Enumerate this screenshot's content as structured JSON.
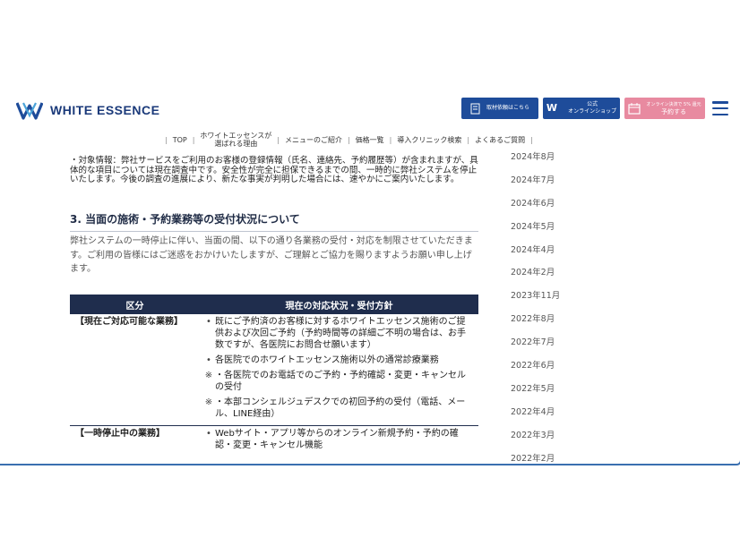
{
  "header": {
    "logo_text": "WHITE ESSENCE",
    "press_button": "取材依頼はこちら",
    "shop_button_line1": "公式",
    "shop_button_line2": "オンラインショップ",
    "reserve_button_small": "オンライン決済で 5% 還元",
    "reserve_button_main": "予約する"
  },
  "nav": {
    "items": [
      "TOP",
      "ホワイトエッセンスが",
      "選ばれる理由",
      "メニューのご紹介",
      "価格一覧",
      "導入クリニック検索",
      "よくあるご質問"
    ]
  },
  "content": {
    "intro": "・対象情報：弊社サービスをご利用のお客様の登録情報（氏名、連絡先、予約履歴等）が含まれますが、具体的な項目については現在調査中です。安全性が完全に担保できるまでの間、一時的に弊社システムを停止いたします。今後の調査の進展により、新たな事実が判明した場合には、速やかにご案内いたします。",
    "heading": "3. 当面の施術・予約業務等の受付状況について",
    "body": "弊社システムの一時停止に伴い、当面の間、以下の通り各業務の受付・対応を制限させていただきます。ご利用の皆様にはご迷惑をおかけいたしますが、ご理解とご協力を賜りますようお願い申し上げます。",
    "table": {
      "col1": "区分",
      "col2": "現在の対応状況・受付方針",
      "row1_cat": "【現在ご対応可能な業務】",
      "row1_items": [
        {
          "mark": "•",
          "text": "既にご予約済のお客様に対するホワイトエッセンス施術のご提供および次回ご予約（予約時間等の詳細ご不明の場合は、お手数ですが、各医院にお問合せ願います）"
        },
        {
          "mark": "•",
          "text": "各医院でのホワイトエッセンス施術以外の通常診療業務"
        },
        {
          "mark": "※",
          "text": "・各医院でのお電話でのご予約・予約確認・変更・キャンセルの受付"
        },
        {
          "mark": "※",
          "text": "・本部コンシェルジュデスクでの初回予約の受付（電話、メール、LINE経由）"
        }
      ],
      "row2_cat": "【一時停止中の業務】",
      "row2_items": [
        {
          "mark": "•",
          "text": "Webサイト・アプリ等からのオンライン新規予約・予約の確認・変更・キャンセル機能"
        }
      ]
    }
  },
  "sidebar": {
    "months": [
      "2024年8月",
      "2024年7月",
      "2024年6月",
      "2024年5月",
      "2024年4月",
      "2024年2月",
      "2023年11月",
      "2022年8月",
      "2022年7月",
      "2022年6月",
      "2022年5月",
      "2022年4月",
      "2022年3月",
      "2022年2月"
    ]
  }
}
